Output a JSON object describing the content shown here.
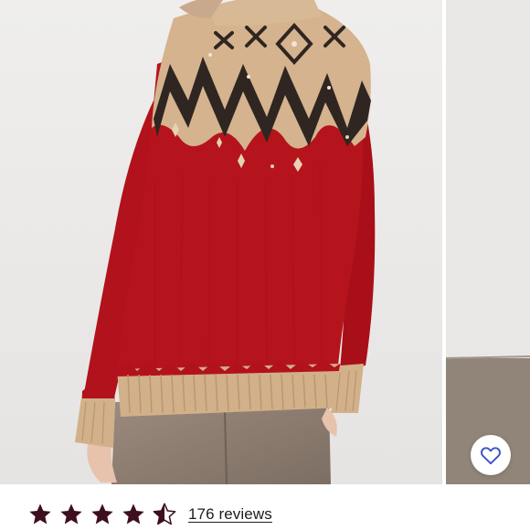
{
  "listing": {
    "rating": 4.5,
    "rating_max": 5,
    "reviews_label": "176 reviews"
  },
  "icons": {
    "favorite": "heart-outline-icon",
    "star": "star-icon"
  },
  "colors": {
    "star": "#3d0f1f",
    "heart": "#3f53c9",
    "sweater_red": "#b2121b",
    "sweater_tan": "#d4b38e",
    "sweater_dark": "#2f2622",
    "background": "#ecebea"
  }
}
